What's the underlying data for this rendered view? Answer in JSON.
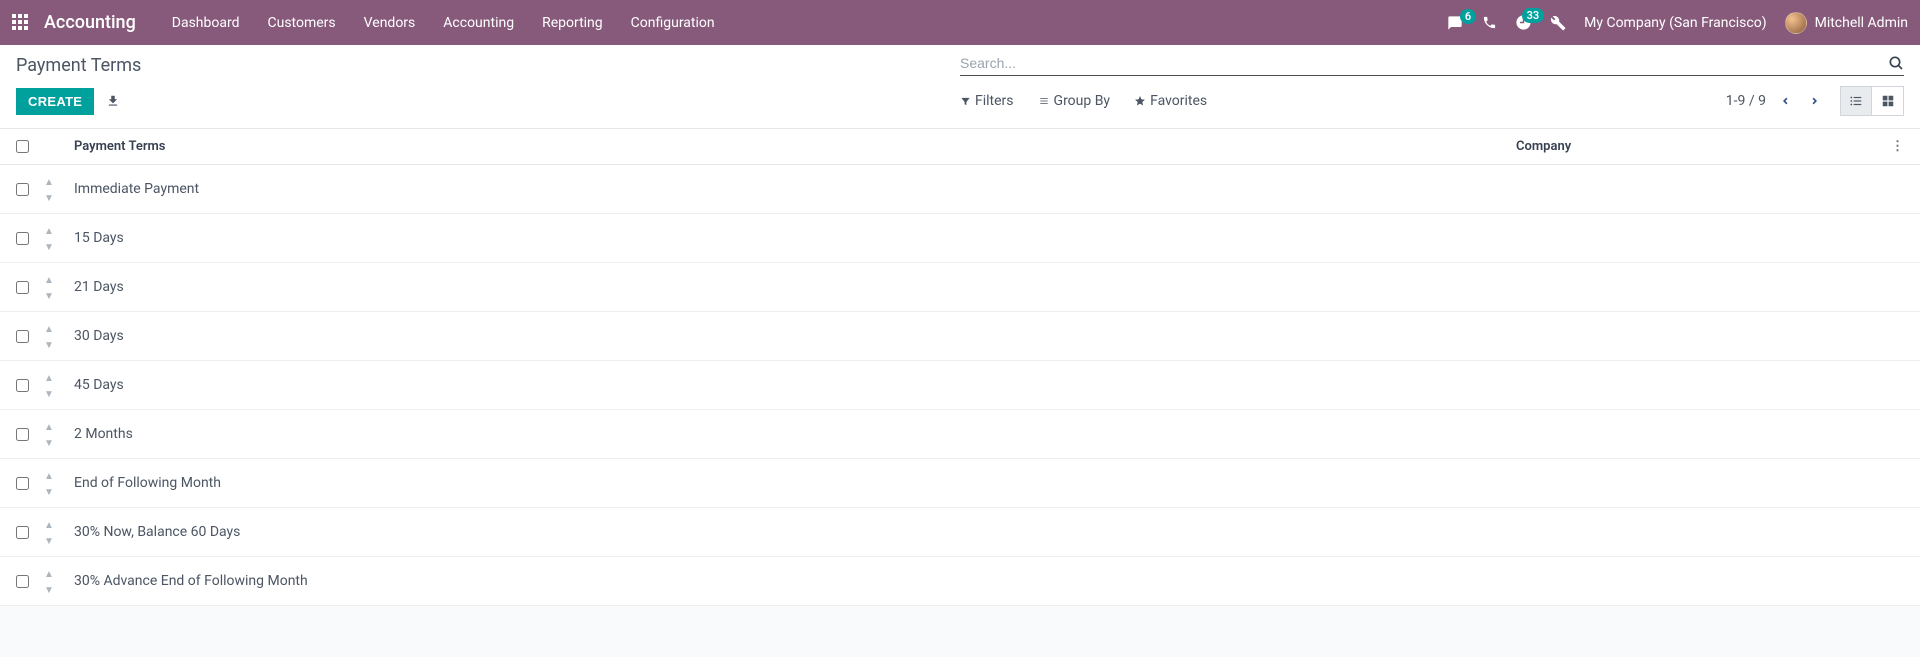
{
  "brand": "Accounting",
  "nav": [
    "Dashboard",
    "Customers",
    "Vendors",
    "Accounting",
    "Reporting",
    "Configuration"
  ],
  "badges": {
    "messages": "6",
    "activities": "33"
  },
  "company": "My Company (San Francisco)",
  "user": "Mitchell Admin",
  "breadcrumb": "Payment Terms",
  "search": {
    "placeholder": "Search..."
  },
  "buttons": {
    "create": "CREATE"
  },
  "searchOptions": {
    "filters": "Filters",
    "groupBy": "Group By",
    "favorites": "Favorites"
  },
  "pager": {
    "range": "1-9 / 9"
  },
  "columns": {
    "name": "Payment Terms",
    "company": "Company"
  },
  "rows": [
    {
      "name": "Immediate Payment",
      "company": ""
    },
    {
      "name": "15 Days",
      "company": ""
    },
    {
      "name": "21 Days",
      "company": ""
    },
    {
      "name": "30 Days",
      "company": ""
    },
    {
      "name": "45 Days",
      "company": ""
    },
    {
      "name": "2 Months",
      "company": ""
    },
    {
      "name": "End of Following Month",
      "company": ""
    },
    {
      "name": "30% Now, Balance 60 Days",
      "company": ""
    },
    {
      "name": "30% Advance End of Following Month",
      "company": ""
    }
  ]
}
